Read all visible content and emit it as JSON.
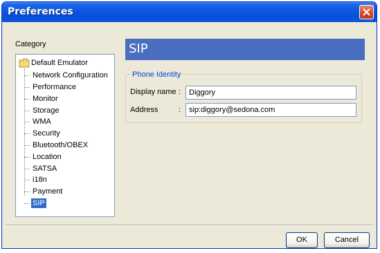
{
  "window": {
    "title": "Preferences"
  },
  "category": {
    "label": "Category",
    "root": "Default Emulator",
    "items": [
      "Network Configuration",
      "Performance",
      "Monitor",
      "Storage",
      "WMA",
      "Security",
      "Bluetooth/OBEX",
      "Location",
      "SATSA",
      "i18n",
      "Payment",
      "SIP"
    ],
    "selected": "SIP"
  },
  "section": {
    "title": "SIP"
  },
  "phone_identity": {
    "legend": "Phone Identity",
    "display_name_label": "Display name",
    "display_name_value": "Diggory",
    "address_label": "Address",
    "address_value": "sip:diggory@sedona.com",
    "colon": ":"
  },
  "buttons": {
    "ok": "OK",
    "cancel": "Cancel"
  },
  "colors": {
    "titlebar": "#0a58e0",
    "header": "#4a6ebf",
    "selection": "#316ac5",
    "legend_text": "#0046d5",
    "dialog_bg": "#ece9d8"
  }
}
